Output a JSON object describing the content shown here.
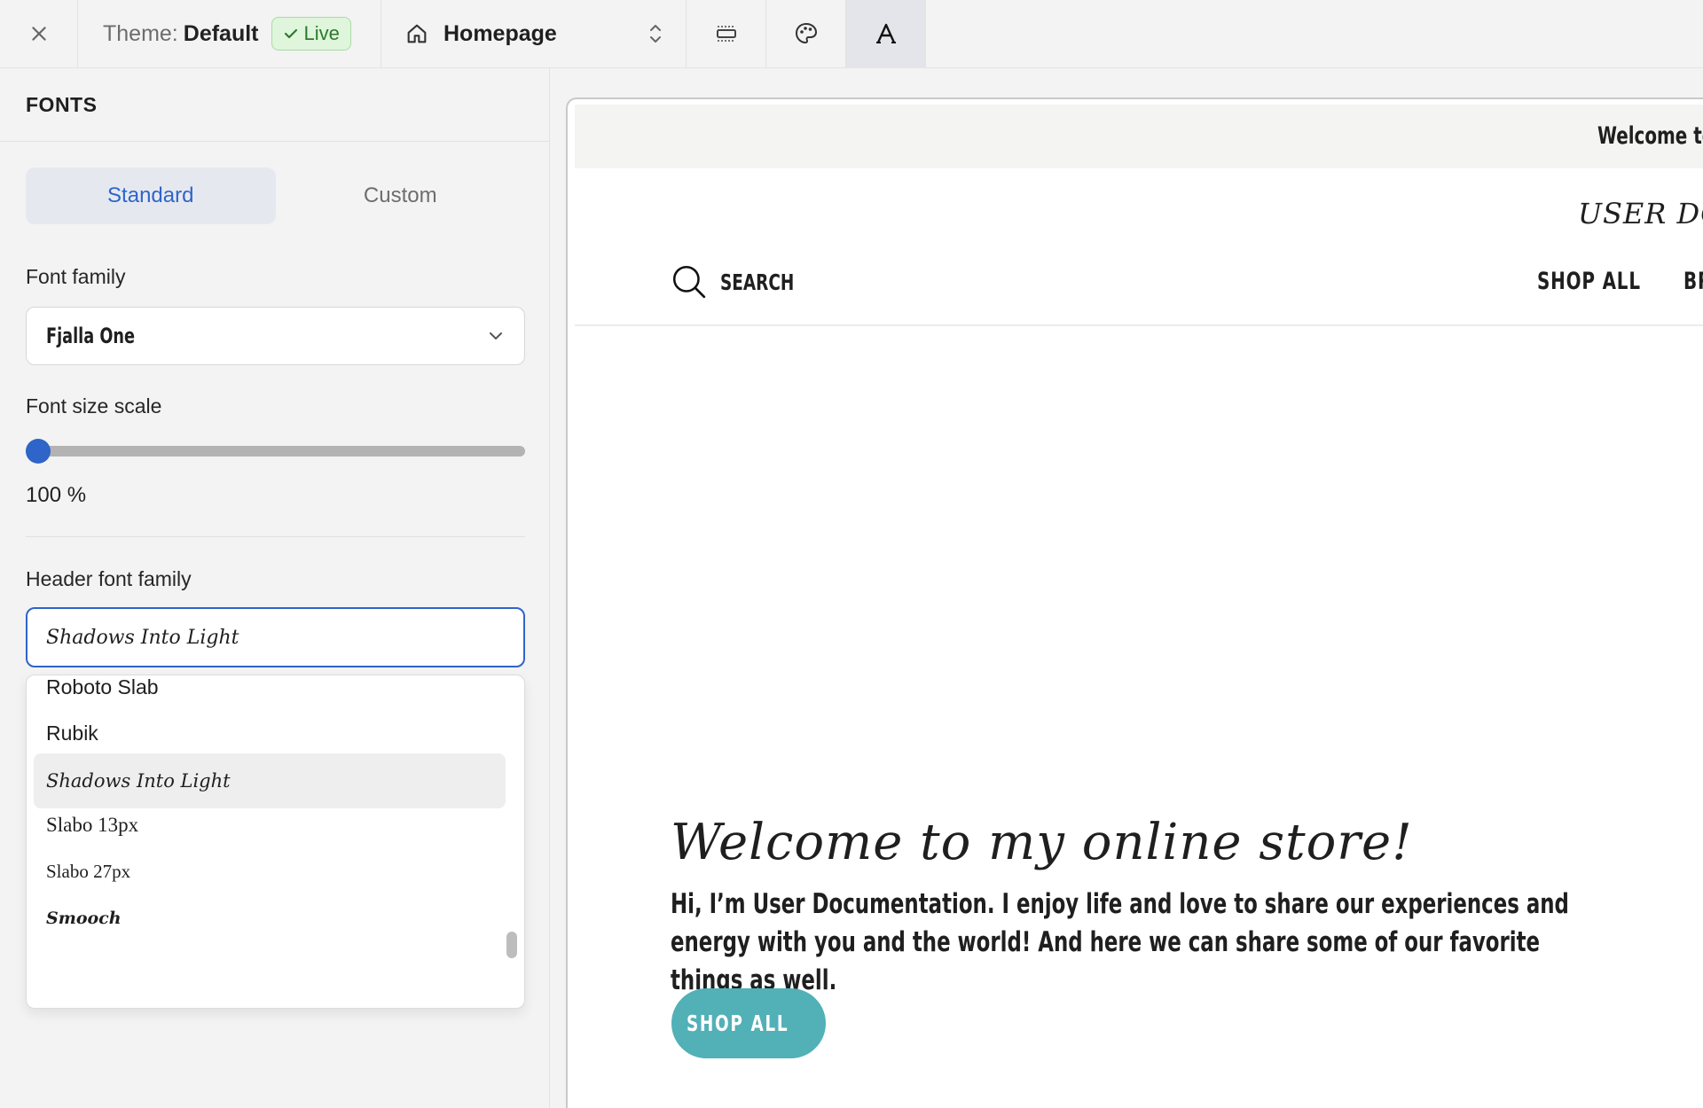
{
  "topbar": {
    "theme_label": "Theme:",
    "theme_name": "Default",
    "live_label": "Live",
    "page_name": "Homepage",
    "colors": {
      "accent": "#2f64c9",
      "live_bg": "#dff5dc",
      "live_text": "#2d7a2a"
    },
    "icons": [
      "close-icon",
      "check-icon",
      "home-icon",
      "up-down-chevron-icon",
      "layout-icon",
      "palette-icon",
      "typography-icon"
    ]
  },
  "sidebar": {
    "title": "FONTS",
    "tabs": {
      "standard": "Standard",
      "custom": "Custom",
      "selected": "Standard"
    },
    "font_family": {
      "label": "Font family",
      "value": "Fjalla One"
    },
    "font_size_scale": {
      "label": "Font size scale",
      "value_text": "100 %",
      "fraction": 0.0
    },
    "header_font_family": {
      "label": "Header font family",
      "value": "Shadows Into Light",
      "options": [
        "Roboto Slab",
        "Rubik",
        "Shadows Into Light",
        "Slabo 13px",
        "Slabo 27px",
        "Smooch"
      ],
      "highlighted": "Shadows Into Light"
    }
  },
  "preview": {
    "announcement": "Welcome to",
    "brand": "USER DOCU",
    "nav": {
      "search": "SEARCH",
      "shop_all": "SHOP ALL",
      "partial": "BR"
    },
    "hero": {
      "title": "Welcome to my online store!",
      "text": "Hi, I’m User Documentation. I enjoy life and love to share our experiences and energy with you and the world! And here we can share some of our favorite things as well.",
      "button": "SHOP ALL",
      "button_color": "#52b0b7"
    }
  }
}
